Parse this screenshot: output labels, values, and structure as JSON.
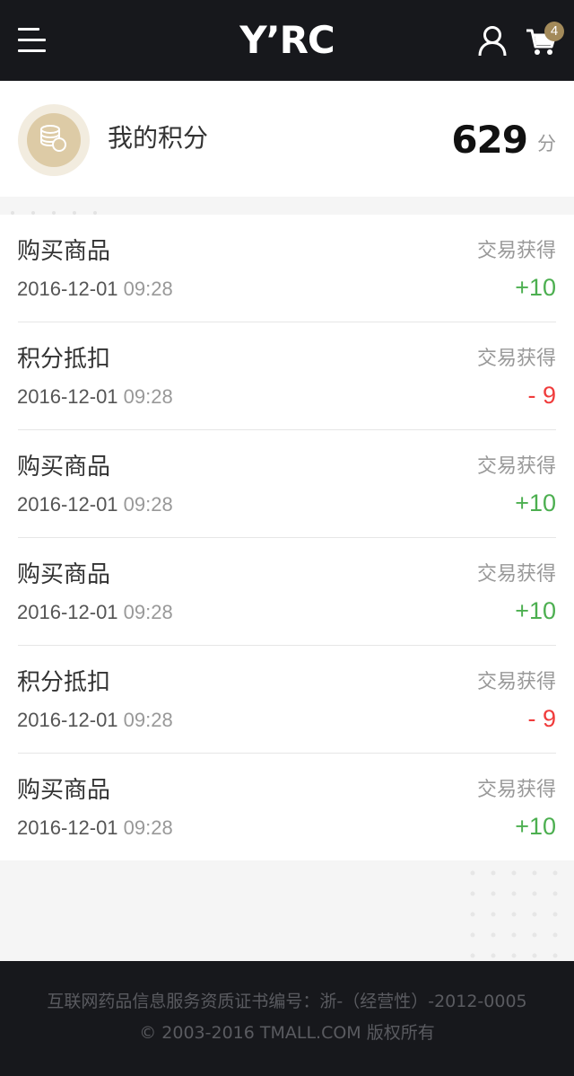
{
  "header": {
    "logo_text": "Y’RC",
    "cart_count": "4",
    "accent_color": "#a38a5a"
  },
  "points": {
    "title": "我的积分",
    "value": "629",
    "unit": "分"
  },
  "records": [
    {
      "title": "购买商品",
      "date": "2016-12-01",
      "time": "09:28",
      "type": "交易获得",
      "amount": "+10",
      "color": "#4caf50"
    },
    {
      "title": "积分抵扣",
      "date": "2016-12-01",
      "time": "09:28",
      "type": "交易获得",
      "amount": "- 9",
      "color": "#f03c3c"
    },
    {
      "title": "购买商品",
      "date": "2016-12-01",
      "time": "09:28",
      "type": "交易获得",
      "amount": "+10",
      "color": "#4caf50"
    },
    {
      "title": "购买商品",
      "date": "2016-12-01",
      "time": "09:28",
      "type": "交易获得",
      "amount": "+10",
      "color": "#4caf50"
    },
    {
      "title": "积分抵扣",
      "date": "2016-12-01",
      "time": "09:28",
      "type": "交易获得",
      "amount": "- 9",
      "color": "#f03c3c"
    },
    {
      "title": "购买商品",
      "date": "2016-12-01",
      "time": "09:28",
      "type": "交易获得",
      "amount": "+10",
      "color": "#4caf50"
    }
  ],
  "footer": {
    "license": "互联网药品信息服务资质证书编号：浙-（经营性）-2012-0005",
    "copyright": "© 2003-2016 TMALL.COM 版权所有"
  },
  "icons": {
    "menu": "hamburger-menu-icon",
    "user": "user-icon",
    "cart": "cart-icon",
    "points": "coins-icon"
  }
}
